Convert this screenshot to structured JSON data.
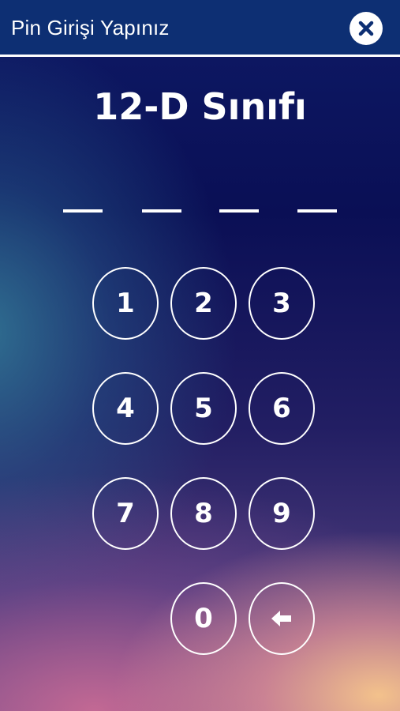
{
  "header": {
    "title": "Pin Girişi Yapınız",
    "close_icon": "close-icon"
  },
  "class_name": "12-D Sınıfı",
  "pin": {
    "length": 4,
    "entered": 0
  },
  "keypad": {
    "keys": [
      "1",
      "2",
      "3",
      "4",
      "5",
      "6",
      "7",
      "8",
      "9",
      "0"
    ],
    "backspace_icon": "arrow-left-icon"
  },
  "colors": {
    "header_bg": "#0d2f73",
    "text": "#ffffff"
  }
}
